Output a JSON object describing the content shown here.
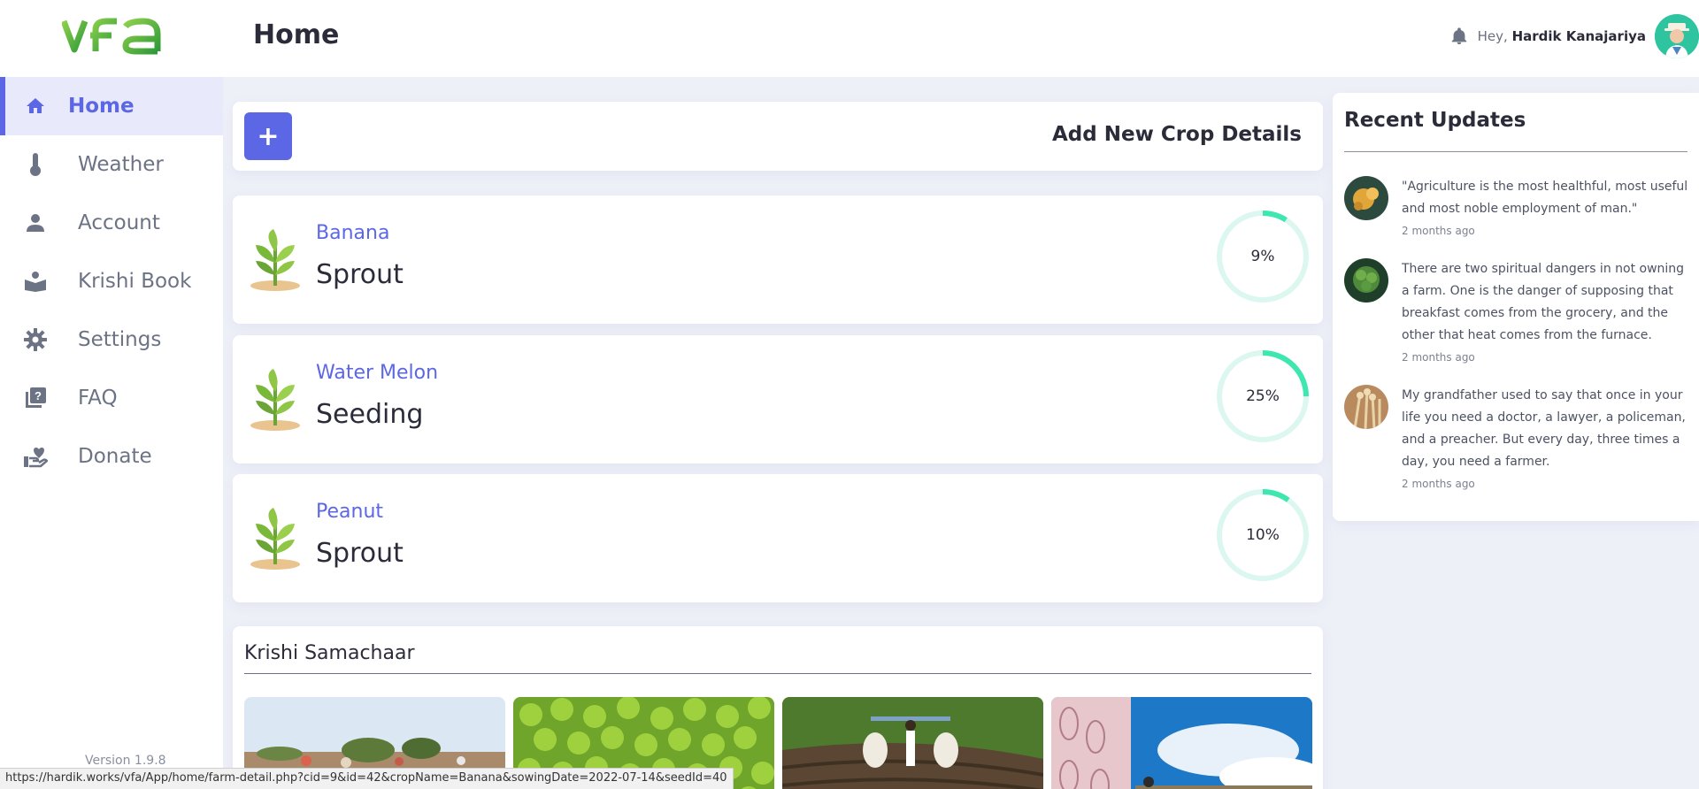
{
  "header": {
    "logo_text": "vfa",
    "page_title": "Home",
    "greeting_prefix": "Hey,",
    "user_name": "Hardik Kanajariya"
  },
  "sidebar": {
    "items": [
      {
        "label": "Home",
        "icon": "home-icon",
        "active": true
      },
      {
        "label": "Weather",
        "icon": "thermometer-icon"
      },
      {
        "label": "Account",
        "icon": "user-icon"
      },
      {
        "label": "Krishi Book",
        "icon": "book-icon"
      },
      {
        "label": "Settings",
        "icon": "gear-icon"
      },
      {
        "label": "FAQ",
        "icon": "faq-icon"
      },
      {
        "label": "Donate",
        "icon": "donate-icon"
      }
    ],
    "version": "Version 1.9.8"
  },
  "add_crop": {
    "button_symbol": "+",
    "label": "Add New Crop Details"
  },
  "crops": [
    {
      "name": "Banana",
      "stage": "Sprout",
      "progress": 9,
      "progress_label": "9%"
    },
    {
      "name": "Water Melon",
      "stage": "Seeding",
      "progress": 25,
      "progress_label": "25%"
    },
    {
      "name": "Peanut",
      "stage": "Sprout",
      "progress": 10,
      "progress_label": "10%"
    }
  ],
  "news": {
    "title": "Krishi Samachaar",
    "images": [
      "farmers-field-photo",
      "green-limes-photo",
      "bullock-plough-photo",
      "currency-farm-photo"
    ]
  },
  "updates": {
    "title": "Recent Updates",
    "items": [
      {
        "text": "\"Agriculture is the most healthful, most useful and most noble employment of man.\"",
        "time": "2 months ago"
      },
      {
        "text": "There are two spiritual dangers in not owning a farm. One is the danger of supposing that breakfast comes from the grocery, and the other that heat comes from the furnace.",
        "time": "2 months ago"
      },
      {
        "text": "My grandfather used to say that once in your life you need a doctor, a lawyer, a policeman, and a preacher. But every day, three times a day, you need a farmer.",
        "time": "2 months ago"
      }
    ]
  },
  "statusbar": {
    "url": "https://hardik.works/vfa/App/home/farm-detail.php?cid=9&id=42&cropName=Banana&sowingDate=2022-07-14&seedId=40"
  },
  "colors": {
    "accent": "#5c67e6",
    "ring_track": "#dcf7ef",
    "ring_fill": "#3ee6b0",
    "logo_green": "#4cb848"
  }
}
